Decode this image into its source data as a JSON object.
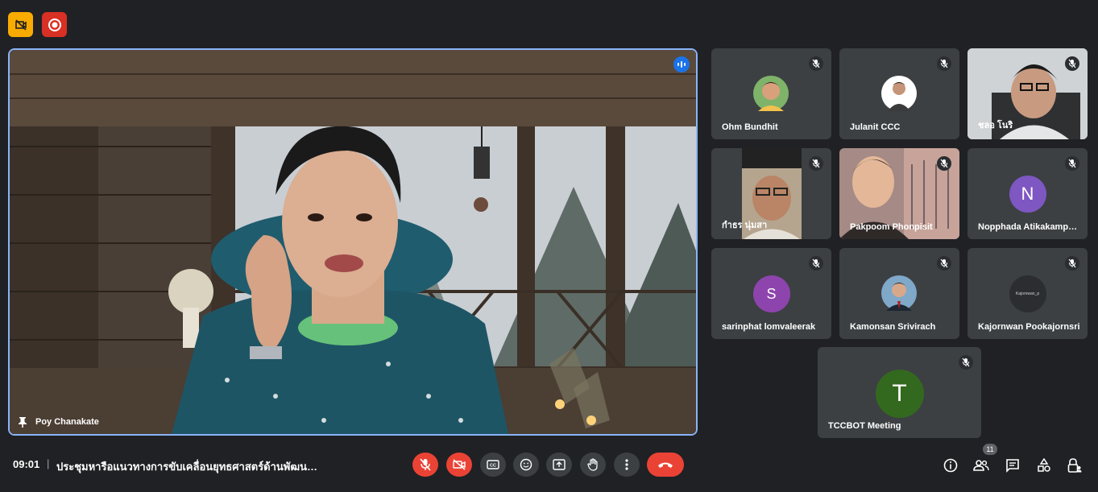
{
  "main": {
    "name": "Poy Chanakate"
  },
  "participants": [
    {
      "name": "Ohm Bundhit"
    },
    {
      "name": "Julanit CCC"
    },
    {
      "name": "ชลอ โนริ"
    },
    {
      "name": "กำธร นุ่มสา"
    },
    {
      "name": "Pakpoom Phonpisit"
    },
    {
      "name": "Nopphada Atikakamphon",
      "initial": "N",
      "color": "#7e57c2"
    },
    {
      "name": "sarinphat lomvaleerak",
      "initial": "S",
      "color": "#8e44ad"
    },
    {
      "name": "Kamonsan Srivirach"
    },
    {
      "name": "Kajornwan Pookajornsri",
      "logo_text": "Kajornwan_p"
    },
    {
      "name": "TCCBOT Meeting",
      "initial": "T",
      "color": "#33691e"
    }
  ],
  "footer": {
    "time": "09:01",
    "separator": "|",
    "meeting_title": "ประชุมหารือแนวทางการขับเคลื่อนยุทธศาสตร์ด้านพัฒนาสังคม",
    "people_count": "11"
  }
}
